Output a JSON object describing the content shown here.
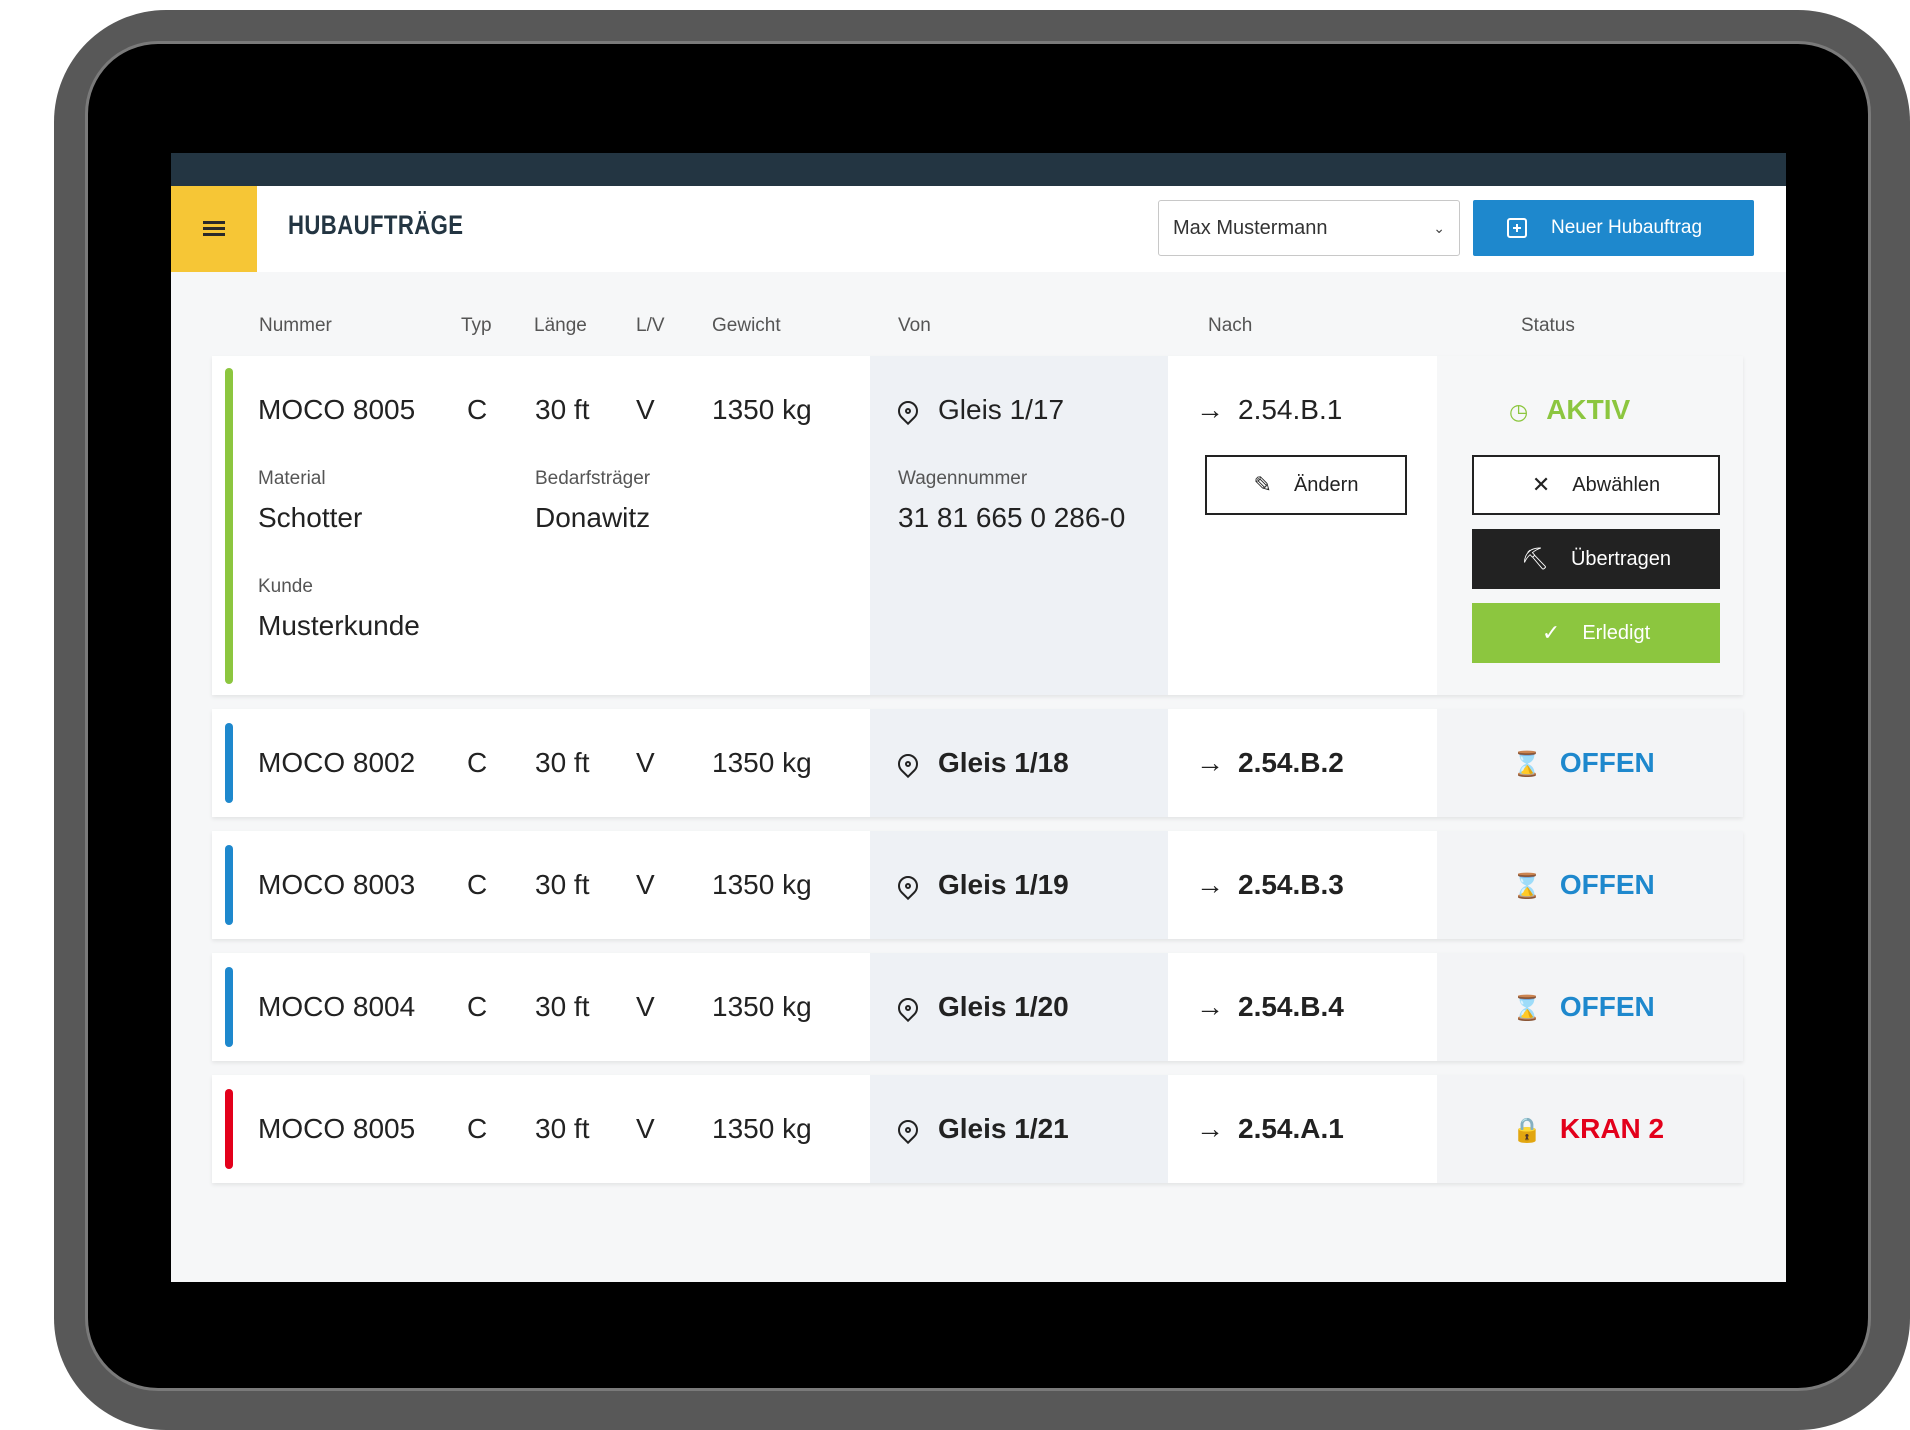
{
  "app": {
    "title": "HUBAUFTRÄGE",
    "menu_icon": "hamburger-icon"
  },
  "user_select": {
    "value": "Max Mustermann"
  },
  "new_order_button": {
    "label": "Neuer Hubauftrag",
    "icon": "add-document-icon"
  },
  "columns": {
    "nummer": "Nummer",
    "typ": "Typ",
    "laenge": "Länge",
    "lv": "L/V",
    "gewicht": "Gewicht",
    "von": "Von",
    "nach": "Nach",
    "status": "Status"
  },
  "colors": {
    "aktiv": "#8cc63f",
    "offen": "#1e88cd",
    "kran": "#e3001b",
    "yellow": "#f6c636",
    "dark": "#233542"
  },
  "active_order": {
    "nummer": "MOCO 8005",
    "typ": "C",
    "laenge": "30 ft",
    "lv": "V",
    "gewicht": "1350 kg",
    "von": "Gleis 1/17",
    "nach": "2.54.B.1",
    "status": "AKTIV",
    "material_label": "Material",
    "material": "Schotter",
    "bedarf_label": "Bedarfsträger",
    "bedarf": "Donawitz",
    "kunde_label": "Kunde",
    "kunde": "Musterkunde",
    "wagen_label": "Wagennummer",
    "wagen": "31 81 665 0 286-0",
    "aendern_label": "Ändern",
    "abwaehlen_label": "Abwählen",
    "uebertragen_label": "Übertragen",
    "erledigt_label": "Erledigt"
  },
  "orders": [
    {
      "nummer": "MOCO 8002",
      "typ": "C",
      "laenge": "30 ft",
      "lv": "V",
      "gewicht": "1350 kg",
      "von": "Gleis 1/18",
      "nach": "2.54.B.2",
      "status": "OFFEN"
    },
    {
      "nummer": "MOCO 8003",
      "typ": "C",
      "laenge": "30 ft",
      "lv": "V",
      "gewicht": "1350 kg",
      "von": "Gleis 1/19",
      "nach": "2.54.B.3",
      "status": "OFFEN"
    },
    {
      "nummer": "MOCO 8004",
      "typ": "C",
      "laenge": "30 ft",
      "lv": "V",
      "gewicht": "1350 kg",
      "von": "Gleis 1/20",
      "nach": "2.54.B.4",
      "status": "OFFEN"
    },
    {
      "nummer": "MOCO 8005",
      "typ": "C",
      "laenge": "30 ft",
      "lv": "V",
      "gewicht": "1350 kg",
      "von": "Gleis 1/21",
      "nach": "2.54.A.1",
      "status": "KRAN 2"
    }
  ]
}
